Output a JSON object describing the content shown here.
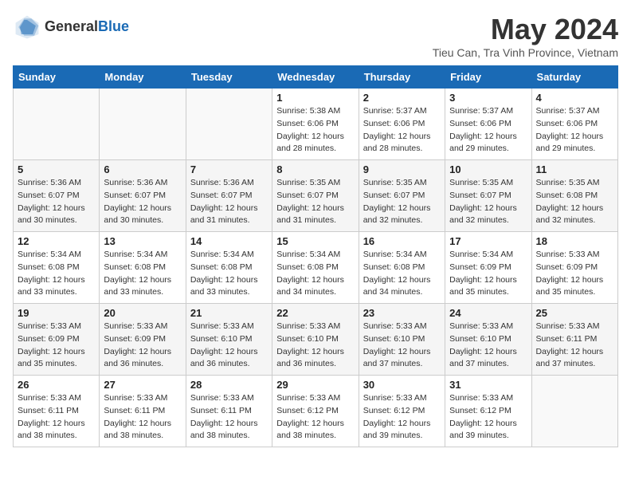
{
  "header": {
    "logo_general": "General",
    "logo_blue": "Blue",
    "month_year": "May 2024",
    "location": "Tieu Can, Tra Vinh Province, Vietnam"
  },
  "days_of_week": [
    "Sunday",
    "Monday",
    "Tuesday",
    "Wednesday",
    "Thursday",
    "Friday",
    "Saturday"
  ],
  "weeks": [
    [
      {
        "day": "",
        "info": ""
      },
      {
        "day": "",
        "info": ""
      },
      {
        "day": "",
        "info": ""
      },
      {
        "day": "1",
        "info": "Sunrise: 5:38 AM\nSunset: 6:06 PM\nDaylight: 12 hours\nand 28 minutes."
      },
      {
        "day": "2",
        "info": "Sunrise: 5:37 AM\nSunset: 6:06 PM\nDaylight: 12 hours\nand 28 minutes."
      },
      {
        "day": "3",
        "info": "Sunrise: 5:37 AM\nSunset: 6:06 PM\nDaylight: 12 hours\nand 29 minutes."
      },
      {
        "day": "4",
        "info": "Sunrise: 5:37 AM\nSunset: 6:06 PM\nDaylight: 12 hours\nand 29 minutes."
      }
    ],
    [
      {
        "day": "5",
        "info": "Sunrise: 5:36 AM\nSunset: 6:07 PM\nDaylight: 12 hours\nand 30 minutes."
      },
      {
        "day": "6",
        "info": "Sunrise: 5:36 AM\nSunset: 6:07 PM\nDaylight: 12 hours\nand 30 minutes."
      },
      {
        "day": "7",
        "info": "Sunrise: 5:36 AM\nSunset: 6:07 PM\nDaylight: 12 hours\nand 31 minutes."
      },
      {
        "day": "8",
        "info": "Sunrise: 5:35 AM\nSunset: 6:07 PM\nDaylight: 12 hours\nand 31 minutes."
      },
      {
        "day": "9",
        "info": "Sunrise: 5:35 AM\nSunset: 6:07 PM\nDaylight: 12 hours\nand 32 minutes."
      },
      {
        "day": "10",
        "info": "Sunrise: 5:35 AM\nSunset: 6:07 PM\nDaylight: 12 hours\nand 32 minutes."
      },
      {
        "day": "11",
        "info": "Sunrise: 5:35 AM\nSunset: 6:08 PM\nDaylight: 12 hours\nand 32 minutes."
      }
    ],
    [
      {
        "day": "12",
        "info": "Sunrise: 5:34 AM\nSunset: 6:08 PM\nDaylight: 12 hours\nand 33 minutes."
      },
      {
        "day": "13",
        "info": "Sunrise: 5:34 AM\nSunset: 6:08 PM\nDaylight: 12 hours\nand 33 minutes."
      },
      {
        "day": "14",
        "info": "Sunrise: 5:34 AM\nSunset: 6:08 PM\nDaylight: 12 hours\nand 33 minutes."
      },
      {
        "day": "15",
        "info": "Sunrise: 5:34 AM\nSunset: 6:08 PM\nDaylight: 12 hours\nand 34 minutes."
      },
      {
        "day": "16",
        "info": "Sunrise: 5:34 AM\nSunset: 6:08 PM\nDaylight: 12 hours\nand 34 minutes."
      },
      {
        "day": "17",
        "info": "Sunrise: 5:34 AM\nSunset: 6:09 PM\nDaylight: 12 hours\nand 35 minutes."
      },
      {
        "day": "18",
        "info": "Sunrise: 5:33 AM\nSunset: 6:09 PM\nDaylight: 12 hours\nand 35 minutes."
      }
    ],
    [
      {
        "day": "19",
        "info": "Sunrise: 5:33 AM\nSunset: 6:09 PM\nDaylight: 12 hours\nand 35 minutes."
      },
      {
        "day": "20",
        "info": "Sunrise: 5:33 AM\nSunset: 6:09 PM\nDaylight: 12 hours\nand 36 minutes."
      },
      {
        "day": "21",
        "info": "Sunrise: 5:33 AM\nSunset: 6:10 PM\nDaylight: 12 hours\nand 36 minutes."
      },
      {
        "day": "22",
        "info": "Sunrise: 5:33 AM\nSunset: 6:10 PM\nDaylight: 12 hours\nand 36 minutes."
      },
      {
        "day": "23",
        "info": "Sunrise: 5:33 AM\nSunset: 6:10 PM\nDaylight: 12 hours\nand 37 minutes."
      },
      {
        "day": "24",
        "info": "Sunrise: 5:33 AM\nSunset: 6:10 PM\nDaylight: 12 hours\nand 37 minutes."
      },
      {
        "day": "25",
        "info": "Sunrise: 5:33 AM\nSunset: 6:11 PM\nDaylight: 12 hours\nand 37 minutes."
      }
    ],
    [
      {
        "day": "26",
        "info": "Sunrise: 5:33 AM\nSunset: 6:11 PM\nDaylight: 12 hours\nand 38 minutes."
      },
      {
        "day": "27",
        "info": "Sunrise: 5:33 AM\nSunset: 6:11 PM\nDaylight: 12 hours\nand 38 minutes."
      },
      {
        "day": "28",
        "info": "Sunrise: 5:33 AM\nSunset: 6:11 PM\nDaylight: 12 hours\nand 38 minutes."
      },
      {
        "day": "29",
        "info": "Sunrise: 5:33 AM\nSunset: 6:12 PM\nDaylight: 12 hours\nand 38 minutes."
      },
      {
        "day": "30",
        "info": "Sunrise: 5:33 AM\nSunset: 6:12 PM\nDaylight: 12 hours\nand 39 minutes."
      },
      {
        "day": "31",
        "info": "Sunrise: 5:33 AM\nSunset: 6:12 PM\nDaylight: 12 hours\nand 39 minutes."
      },
      {
        "day": "",
        "info": ""
      }
    ]
  ]
}
